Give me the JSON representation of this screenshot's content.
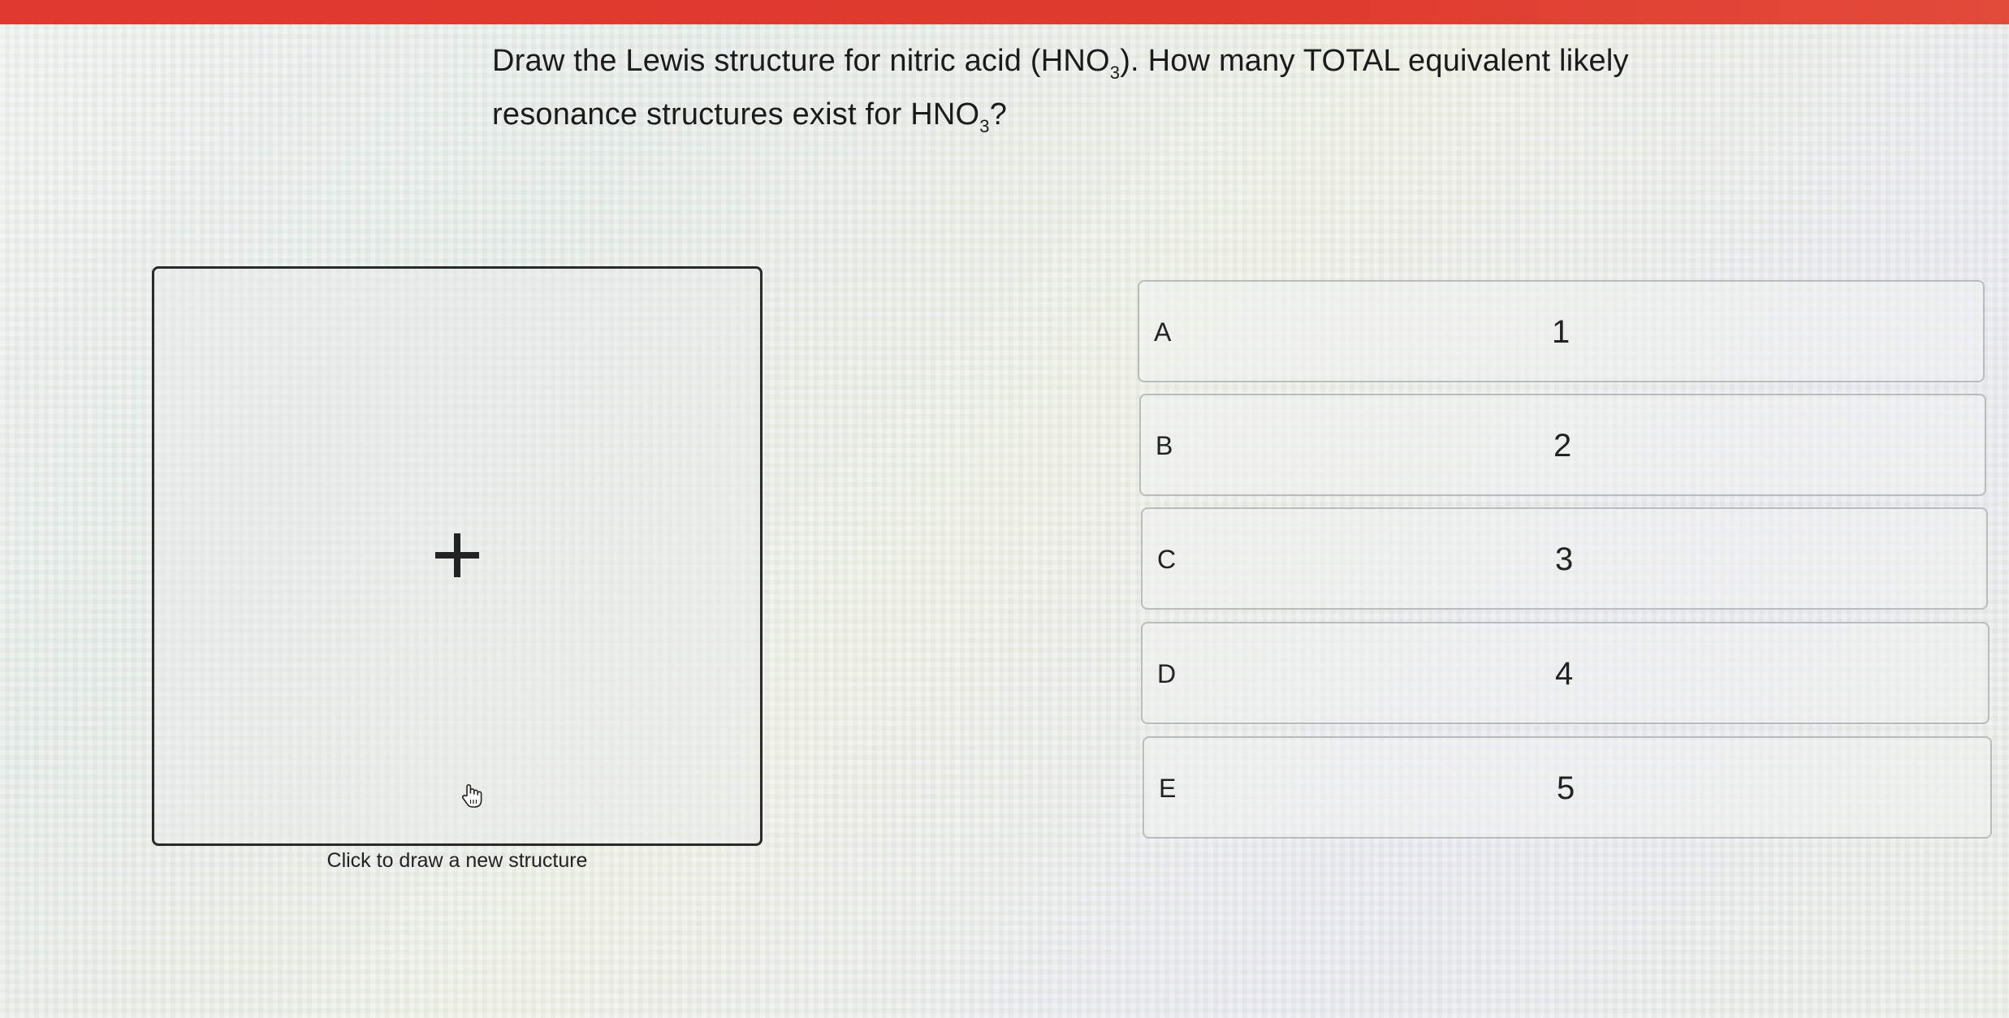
{
  "question": {
    "line1_before": "Draw the Lewis structure for nitric acid (HNO",
    "line1_sub": "3",
    "line1_after": "). How many TOTAL equivalent likely",
    "line2_before": "resonance structures exist for HNO",
    "line2_sub": "3",
    "line2_after": "?"
  },
  "drawing": {
    "caption": "Click to draw a new structure",
    "icons": [
      "plus-icon",
      "hand-cursor-icon"
    ]
  },
  "options": [
    {
      "letter": "A",
      "value": "1"
    },
    {
      "letter": "B",
      "value": "2"
    },
    {
      "letter": "C",
      "value": "3"
    },
    {
      "letter": "D",
      "value": "4"
    },
    {
      "letter": "E",
      "value": "5"
    }
  ],
  "colors": {
    "top_bar": "#e03a30"
  }
}
